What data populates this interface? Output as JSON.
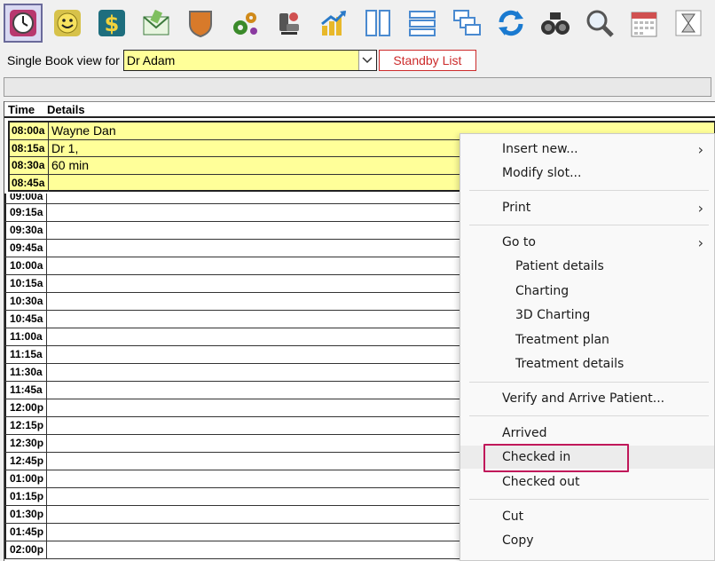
{
  "toolbar": {
    "icons": [
      "appointments-clock-icon",
      "smiley-icon",
      "dollar-icon",
      "mail-icon",
      "shield-icon",
      "gears-icon",
      "dental-chair-icon",
      "growth-chart-icon",
      "two-columns-icon",
      "rows-icon",
      "windows-icon",
      "refresh-icon",
      "binoculars-icon",
      "magnifier-icon",
      "calendar-icon",
      "hourglass-icon"
    ]
  },
  "view": {
    "label": "Single Book view for",
    "doctor": "Dr Adam",
    "standby": "Standby List"
  },
  "grid": {
    "header_time": "Time",
    "header_details": "Details",
    "appointment": [
      {
        "time": "08:00a",
        "detail": " Wayne Dan"
      },
      {
        "time": "08:15a",
        "detail": "Dr 1,"
      },
      {
        "time": "08:30a",
        "detail": "60 min"
      },
      {
        "time": "08:45a",
        "detail": ""
      }
    ],
    "partial_slot": "09:00a",
    "slots": [
      "09:15a",
      "09:30a",
      "09:45a",
      "10:00a",
      "10:15a",
      "10:30a",
      "10:45a",
      "11:00a",
      "11:15a",
      "11:30a",
      "11:45a",
      "12:00p",
      "12:15p",
      "12:30p",
      "12:45p",
      "01:00p",
      "01:15p",
      "01:30p",
      "01:45p",
      "02:00p"
    ]
  },
  "menu": {
    "insert_new": "Insert new...",
    "modify_slot": "Modify slot...",
    "print": "Print",
    "go_to": "Go to",
    "patient_details": "Patient details",
    "charting": "Charting",
    "charting_3d": "3D Charting",
    "treatment_plan": "Treatment plan",
    "treatment_details": "Treatment details",
    "verify_arrive": "Verify and Arrive Patient...",
    "arrived": "Arrived",
    "checked_in": "Checked in",
    "checked_out": "Checked out",
    "cut": "Cut",
    "copy": "Copy"
  }
}
